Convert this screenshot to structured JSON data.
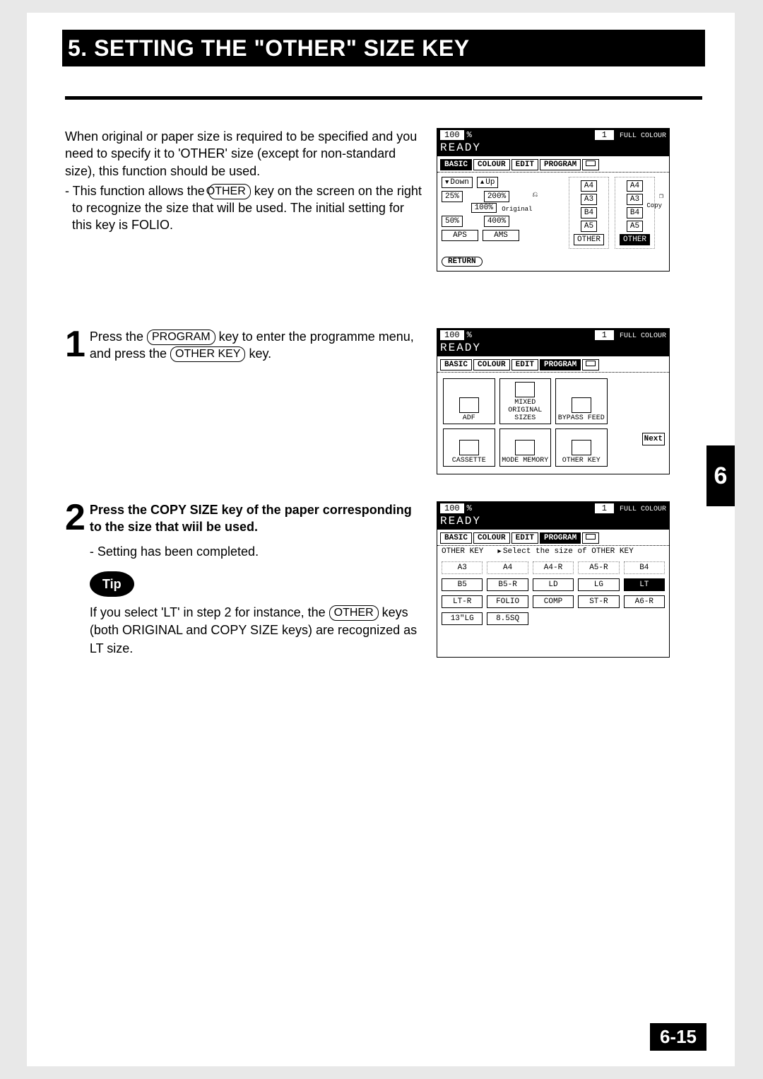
{
  "title": "5. SETTING THE \"OTHER\" SIZE KEY",
  "intro": {
    "p1": "When original or paper size is required to be specified and you need to specify it to 'OTHER' size (except for non-standard size), this function should be used.",
    "p2_pre": "- This function allows the ",
    "p2_key": "OTHER",
    "p2_post": " key on the screen on the right to recognize the size that will be used. The initial setting for this key is FOLIO."
  },
  "screen_header": {
    "ratio_num": "100",
    "ratio_unit": "%",
    "count": "1",
    "mode": "FULL COLOUR",
    "ready": "READY"
  },
  "tabs": {
    "basic": "BASIC",
    "colour": "COLOUR",
    "edit": "EDIT",
    "program": "PROGRAM"
  },
  "screen1": {
    "down": "Down",
    "up": "Up",
    "p25": "25%",
    "p200": "200%",
    "p100": "100%",
    "p50": "50%",
    "p400": "400%",
    "aps": "APS",
    "ams": "AMS",
    "original_lbl": "Original",
    "copy_lbl": "Copy",
    "sizes_left": [
      "A4",
      "A3",
      "B4",
      "A5",
      "OTHER"
    ],
    "sizes_right": [
      "A4",
      "A3",
      "B4",
      "A5",
      "OTHER"
    ],
    "return": "RETURN"
  },
  "step1": {
    "num": "1",
    "l1_pre": "Press the ",
    "l1_key1": "PROGRAM",
    "l1_mid": " key to enter the programme menu, and press the ",
    "l1_key2": "OTHER KEY",
    "l1_post": " key."
  },
  "screen2": {
    "cells": [
      {
        "label": "ADF"
      },
      {
        "label": "MIXED\nORIGINAL SIZES"
      },
      {
        "label": "BYPASS FEED"
      },
      {
        "label": ""
      },
      {
        "label": "CASSETTE"
      },
      {
        "label": "MODE MEMORY"
      },
      {
        "label": "OTHER KEY"
      },
      {
        "label": ""
      }
    ],
    "next": "Next"
  },
  "step2": {
    "num": "2",
    "heading": "Press the  COPY SIZE  key of the paper corresponding to the size that wiil be used.",
    "note": "-  Setting has been completed.",
    "tip_label": "Tip",
    "tip_pre": "If you select 'LT' in step 2 for instance, the ",
    "tip_key": "OTHER",
    "tip_post": " keys (both ORIGINAL and COPY SIZE keys) are recognized as LT size."
  },
  "screen3": {
    "left_label": "OTHER KEY",
    "instruction": "Select the size of OTHER KEY",
    "row1": [
      "A3",
      "A4",
      "A4-R",
      "A5-R",
      "B4"
    ],
    "row2": [
      "B5",
      "B5-R",
      "LD",
      "LG",
      "LT"
    ],
    "row3": [
      "LT-R",
      "FOLIO",
      "COMP",
      "ST-R",
      "A6-R"
    ],
    "row4": [
      "13\"LG",
      "8.5SQ"
    ],
    "dotted_cols_row1": [
      0,
      1,
      2,
      3,
      4
    ],
    "selected": "LT"
  },
  "side_tab": "6",
  "page_num": "6-15"
}
